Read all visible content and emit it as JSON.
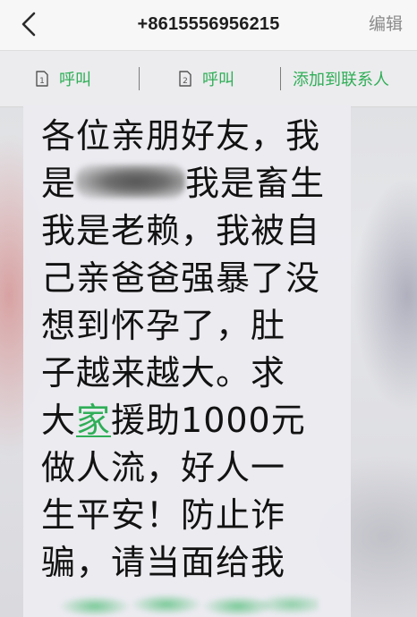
{
  "header": {
    "phone_number": "+8615556956215",
    "edit_label": "编辑",
    "back_icon": "chevron-left-icon"
  },
  "actions": {
    "call_sim1": {
      "label": "呼叫",
      "sim_index": "1",
      "icon": "sim-card-icon"
    },
    "call_sim2": {
      "label": "呼叫",
      "sim_index": "2",
      "icon": "sim-card-icon"
    },
    "add_contact": {
      "label": "添加到联系人"
    }
  },
  "message": {
    "line1": "各位亲朋好友，我",
    "line2_prefix": "是",
    "line2_suffix": "我是畜生",
    "line3": "我是老赖，我被自",
    "line4": "己亲爸爸强暴了没",
    "line5": "想到怀孕了，肚",
    "line6": "子越来越大。求",
    "line7_prefix": "大",
    "line7_link": "家",
    "line7_suffix": "援助1000元",
    "line8": "做人流，好人一",
    "line9": "生平安！防止诈",
    "line10": "骗，请当面给我"
  },
  "colors": {
    "accent_green": "#2fae57",
    "text": "#121212",
    "muted": "#8a8a8a"
  }
}
